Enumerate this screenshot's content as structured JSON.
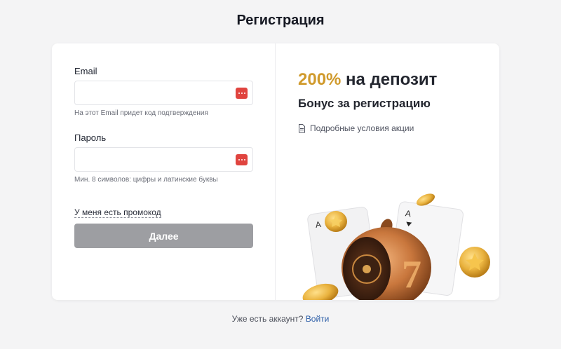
{
  "page": {
    "title": "Регистрация"
  },
  "form": {
    "email": {
      "label": "Email",
      "value": "",
      "hint": "На этот Email придет код подтверждения"
    },
    "password": {
      "label": "Пароль",
      "value": "",
      "hint": "Мин. 8 символов: цифры и латинские буквы"
    },
    "promo_link": "У меня есть промокод",
    "next_button": "Далее"
  },
  "promo": {
    "percent": "200%",
    "headline_rest": " на депозит",
    "subtitle": "Бонус за регистрацию",
    "terms_link": "Подробные условия акции"
  },
  "footer": {
    "question": "Уже есть аккаунт?",
    "login_link": "Войти"
  },
  "colors": {
    "accent_gold": "#d09a2c",
    "button_disabled": "#9d9ea2",
    "link_blue": "#2e5fa8",
    "password_manager_badge": "#e0443f"
  },
  "icons": {
    "password_manager": "password-manager-icon",
    "terms": "document-icon"
  }
}
